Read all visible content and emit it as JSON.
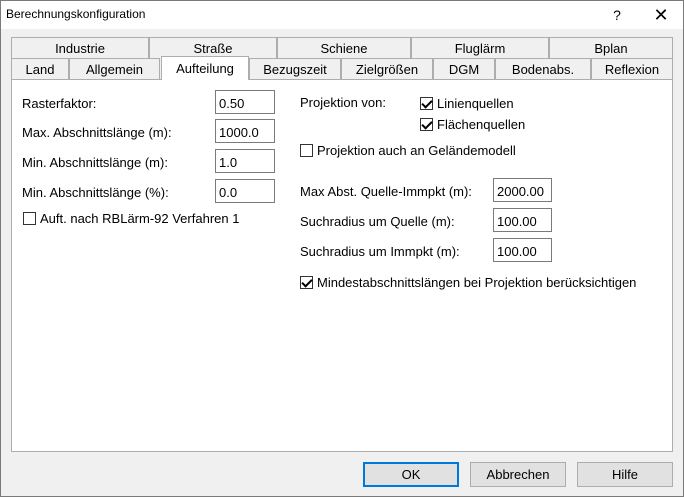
{
  "window": {
    "title": "Berechnungskonfiguration",
    "help_glyph": "?",
    "close_glyph": "✕"
  },
  "tabs": {
    "row_back": [
      "Industrie",
      "Straße",
      "Schiene",
      "Fluglärm",
      "Bplan"
    ],
    "row_front": [
      "Land",
      "Allgemein",
      "Aufteilung",
      "Bezugszeit",
      "Zielgrößen",
      "DGM",
      "Bodenabs.",
      "Reflexion"
    ],
    "active": "Aufteilung"
  },
  "left": {
    "rasterfaktor_label": "Rasterfaktor:",
    "rasterfaktor_value": "0.50",
    "max_abschnitt_label": "Max. Abschnittslänge (m):",
    "max_abschnitt_value": "1000.0",
    "min_abschnitt_m_label": "Min. Abschnittslänge (m):",
    "min_abschnitt_m_value": "1.0",
    "min_abschnitt_pct_label": "Min. Abschnittslänge (%):",
    "min_abschnitt_pct_value": "0.0",
    "rbl_checkbox_label": "Auft. nach RBLärm-92 Verfahren 1",
    "rbl_checked": false
  },
  "right": {
    "projektion_label": "Projektion von:",
    "linienquellen_label": "Linienquellen",
    "linienquellen_checked": true,
    "flaechenquellen_label": "Flächenquellen",
    "flaechenquellen_checked": true,
    "gelaende_label": "Projektion auch an Geländemodell",
    "gelaende_checked": false,
    "max_abst_label": "Max Abst. Quelle-Immpkt (m):",
    "max_abst_value": "2000.00",
    "suchradius_quelle_label": "Suchradius um Quelle (m):",
    "suchradius_quelle_value": "100.00",
    "suchradius_immpkt_label": "Suchradius um Immpkt (m):",
    "suchradius_immpkt_value": "100.00",
    "mindest_label": "Mindestabschnittslängen bei Projektion berücksichtigen",
    "mindest_checked": true
  },
  "buttons": {
    "ok": "OK",
    "cancel": "Abbrechen",
    "help": "Hilfe"
  }
}
